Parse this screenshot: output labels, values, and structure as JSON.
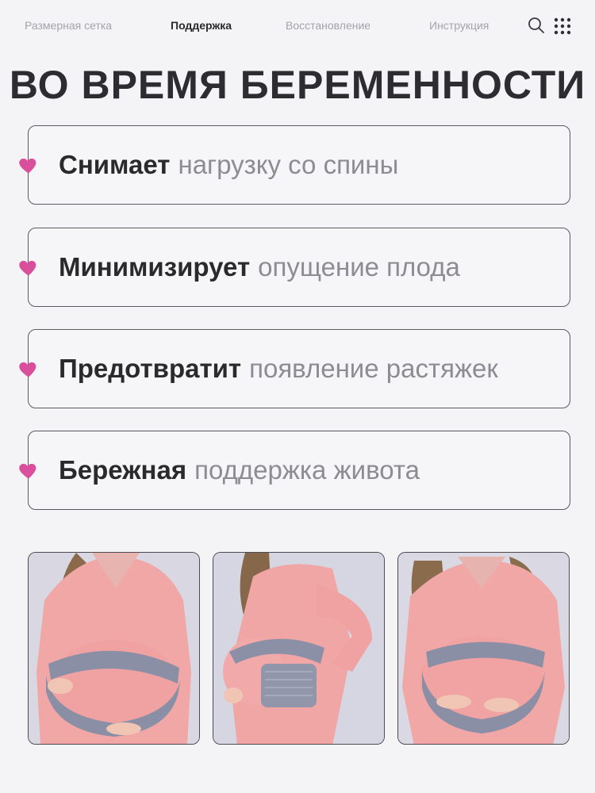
{
  "nav": {
    "items": [
      {
        "label": "Размерная сетка",
        "active": false
      },
      {
        "label": "Поддержка",
        "active": true
      },
      {
        "label": "Восстановление",
        "active": false
      },
      {
        "label": "Инструкция",
        "active": false
      }
    ],
    "search_icon": "search-icon",
    "menu_icon": "grid-menu-icon"
  },
  "title": "ВО ВРЕМЯ БЕРЕМЕННОСТИ",
  "features": [
    {
      "bold": "Снимает",
      "light": "нагрузку со спины"
    },
    {
      "bold": "Минимизирует",
      "light": "опущение плода"
    },
    {
      "bold": "Предотвратит",
      "light": "появление растяжек"
    },
    {
      "bold": "Бережная",
      "light": "поддержка живота"
    }
  ],
  "colors": {
    "accent_heart": "#d94f9c",
    "background": "#f4f4f7",
    "text_dark": "#2a2a2d",
    "text_muted": "#8c8c92"
  },
  "photos": [
    {
      "name": "photo-front-view"
    },
    {
      "name": "photo-side-view"
    },
    {
      "name": "photo-front-hands-view"
    }
  ]
}
